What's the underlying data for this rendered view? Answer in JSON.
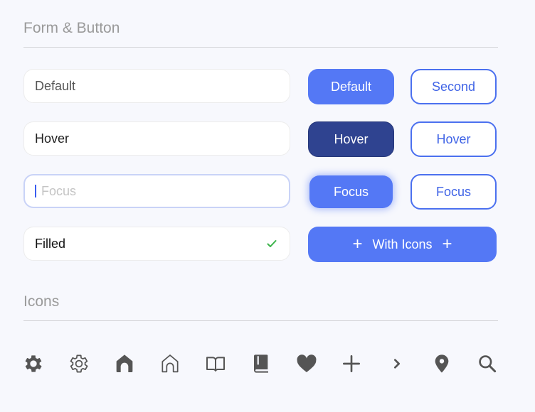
{
  "sections": {
    "form_button_title": "Form & Button",
    "icons_title": "Icons"
  },
  "inputs": {
    "default": {
      "value": "Default"
    },
    "hover": {
      "value": "Hover"
    },
    "focus": {
      "placeholder": "Focus",
      "value": ""
    },
    "filled": {
      "value": "Filled",
      "status_icon": "check-icon"
    }
  },
  "buttons": {
    "primary_default": "Default",
    "secondary_default": "Second",
    "primary_hover": "Hover",
    "secondary_hover": "Hover",
    "primary_focus": "Focus",
    "secondary_focus": "Focus",
    "with_icons": {
      "label": "With Icons",
      "leading_icon": "plus-icon",
      "trailing_icon": "plus-icon"
    }
  },
  "icons": [
    "gear-filled-icon",
    "gear-outline-icon",
    "home-filled-icon",
    "home-outline-icon",
    "book-open-icon",
    "book-filled-icon",
    "heart-filled-icon",
    "plus-icon",
    "chevron-right-icon",
    "location-pin-icon",
    "search-icon"
  ],
  "colors": {
    "primary": "#5478f5",
    "primary_hover": "#2f4390",
    "outline": "#4b70ef",
    "success": "#3bb34a",
    "icon": "#555555",
    "background": "#f7f8fd"
  }
}
